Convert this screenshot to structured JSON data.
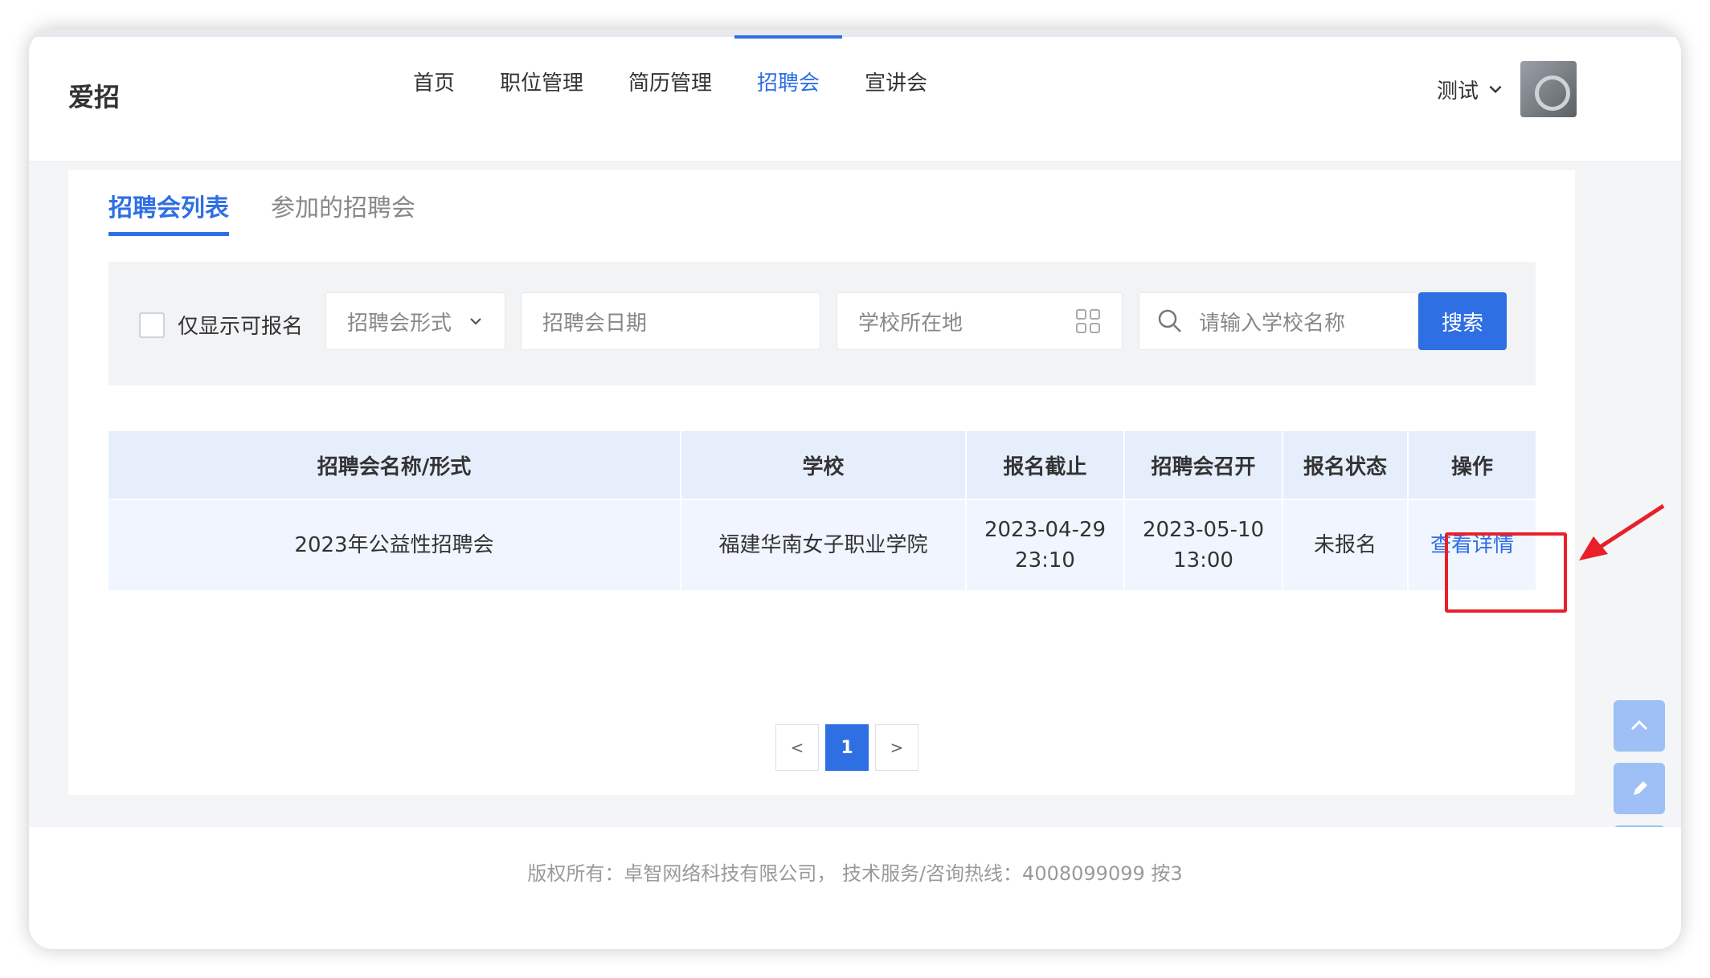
{
  "header": {
    "logo": "爱招",
    "nav": [
      "首页",
      "职位管理",
      "简历管理",
      "招聘会",
      "宣讲会"
    ],
    "active_nav": "招聘会",
    "user_name": "测试"
  },
  "tabs": [
    "招聘会列表",
    "参加的招聘会"
  ],
  "filter": {
    "checkbox_label": "仅显示可报名",
    "form_select": "招聘会形式",
    "date_placeholder": "招聘会日期",
    "location_placeholder": "学校所在地",
    "search_placeholder": "请输入学校名称",
    "search_button": "搜索"
  },
  "table": {
    "headers": [
      "招聘会名称/形式",
      "学校",
      "报名截止",
      "招聘会召开",
      "报名状态",
      "操作"
    ],
    "rows": [
      {
        "name": "2023年公益性招聘会",
        "school": "福建华南女子职业学院",
        "deadline_date": "2023-04-29",
        "deadline_time": "23:10",
        "open_date": "2023-05-10",
        "open_time": "13:00",
        "status": "未报名",
        "action": "查看详情"
      }
    ]
  },
  "pagination": {
    "prev": "<",
    "current": "1",
    "next": ">"
  },
  "footer": "版权所有：卓智网络科技有限公司， 技术服务/咨询热线：4008099099 按3",
  "colors": {
    "accent": "#2f6fe4",
    "highlight": "#e8202a"
  }
}
